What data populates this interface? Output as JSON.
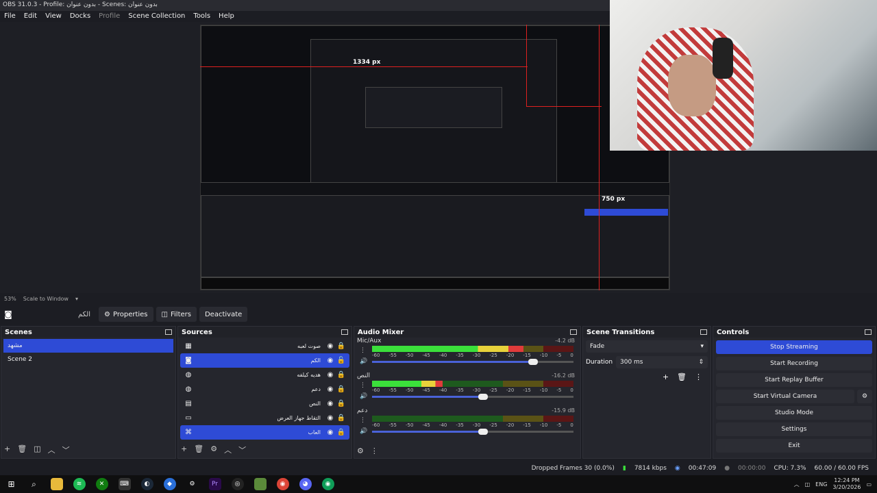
{
  "window": {
    "title": "OBS 31.0.3 - Profile: بدون عنوان - Scenes: بدون عنوان"
  },
  "menu": {
    "items": [
      "File",
      "Edit",
      "View",
      "Docks",
      "Profile",
      "Scene Collection",
      "Tools",
      "Help"
    ]
  },
  "preview": {
    "width_label": "1334 px",
    "height_label": "750 px",
    "inner_width_label": "750 px"
  },
  "scale": {
    "percent": "53%",
    "mode": "Scale to Window"
  },
  "toolbar": {
    "source_name": "الكم",
    "properties": "Properties",
    "filters": "Filters",
    "deactivate": "Deactivate"
  },
  "scenes": {
    "title": "Scenes",
    "items": [
      {
        "label": "مشهد",
        "selected": true
      },
      {
        "label": "Scene 2",
        "selected": false
      }
    ]
  },
  "sources": {
    "title": "Sources",
    "items": [
      {
        "label": "صوت لعبه",
        "icon": "monitor-icon",
        "selected": false
      },
      {
        "label": "الكم",
        "icon": "camera-icon",
        "selected": true
      },
      {
        "label": "هديه كيلفه",
        "icon": "globe-icon",
        "selected": false
      },
      {
        "label": "دعم",
        "icon": "globe-icon",
        "selected": false
      },
      {
        "label": "النص",
        "icon": "text-icon",
        "selected": false
      },
      {
        "label": "التقاط جهاز العرض",
        "icon": "display-icon",
        "selected": false
      },
      {
        "label": "العاب",
        "icon": "gamepad-icon",
        "selected": true
      }
    ]
  },
  "mixer": {
    "title": "Audio Mixer",
    "channels": [
      {
        "name": "Mic/Aux",
        "db": "-4.2 dB",
        "level": 0.75,
        "volume": 0.8
      },
      {
        "name": "النص",
        "db": "-16.2 dB",
        "level": 0.35,
        "volume": 0.55
      },
      {
        "name": "دعم",
        "db": "-15.9 dB",
        "level": 0.0,
        "volume": 0.55
      }
    ],
    "ticks": [
      "-60",
      "-55",
      "-50",
      "-45",
      "-40",
      "-35",
      "-30",
      "-25",
      "-20",
      "-15",
      "-10",
      "-5",
      "0"
    ]
  },
  "transitions": {
    "title": "Scene Transitions",
    "selected": "Fade",
    "duration_label": "Duration",
    "duration_value": "300 ms"
  },
  "controls": {
    "title": "Controls",
    "stop_streaming": "Stop Streaming",
    "start_recording": "Start Recording",
    "start_replay": "Start Replay Buffer",
    "start_virtual": "Start Virtual Camera",
    "studio_mode": "Studio Mode",
    "settings": "Settings",
    "exit": "Exit"
  },
  "status": {
    "dropped": "Dropped Frames 30 (0.0%)",
    "bitrate": "7814 kbps",
    "stream_time": "00:47:09",
    "rec_time": "00:00:00",
    "cpu": "CPU: 7.3%",
    "fps": "60.00 / 60.00 FPS"
  },
  "tray": {
    "lang": "ENG",
    "time": "12:24 PM",
    "date": "3/20/2026"
  },
  "colors": {
    "accent": "#2e4bd6",
    "bg": "#1c1d23",
    "dock": "#25262d",
    "guide": "#e02020"
  }
}
